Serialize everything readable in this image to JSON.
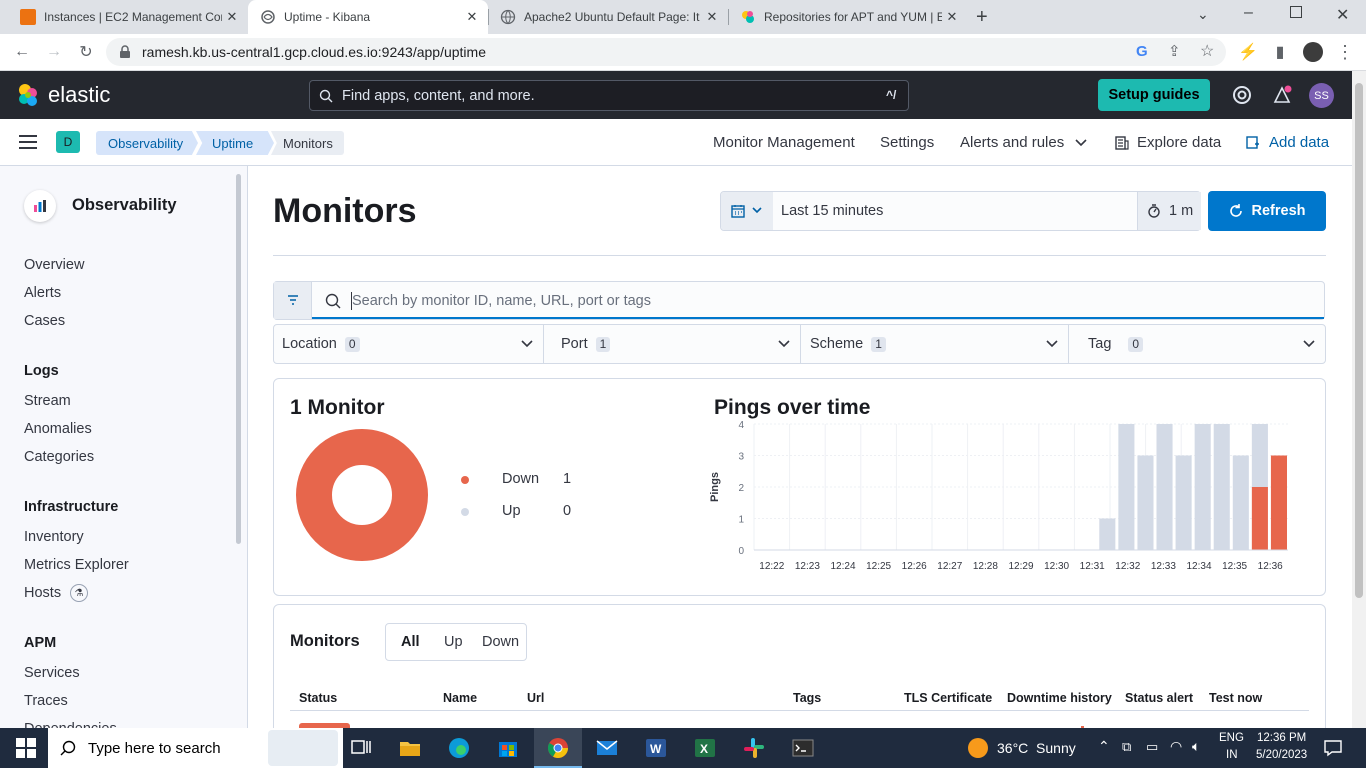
{
  "browser": {
    "tabs": [
      {
        "title": "Instances | EC2 Management Cor",
        "favicon_color": "#ec7211"
      },
      {
        "title": "Uptime - Kibana",
        "favicon_color": "#5f6368"
      },
      {
        "title": "Apache2 Ubuntu Default Page: It",
        "favicon_color": "#5f6368"
      },
      {
        "title": "Repositories for APT and YUM | E",
        "favicon_color": "#00bfb3"
      }
    ],
    "url": "ramesh.kb.us-central1.gcp.cloud.es.io:9243/app/uptime"
  },
  "kibana": {
    "logo_text": "elastic",
    "search_placeholder": "Find apps, content, and more.",
    "search_shortcut": "^/",
    "setup_label": "Setup guides",
    "avatar": "SS",
    "space": "D",
    "breadcrumbs": [
      "Observability",
      "Uptime",
      "Monitors"
    ],
    "nav": {
      "monitor_management": "Monitor Management",
      "settings": "Settings",
      "alerts_rules": "Alerts and rules",
      "explore": "Explore data",
      "add_data": "Add data"
    }
  },
  "sidebar": {
    "title": "Observability",
    "items_top": [
      "Overview",
      "Alerts",
      "Cases"
    ],
    "logs_head": "Logs",
    "logs": [
      "Stream",
      "Anomalies",
      "Categories"
    ],
    "infra_head": "Infrastructure",
    "infra": [
      "Inventory",
      "Metrics Explorer",
      "Hosts"
    ],
    "apm_head": "APM",
    "apm": [
      "Services",
      "Traces",
      "Dependencies"
    ]
  },
  "page": {
    "title": "Monitors",
    "time_range": "Last 15 minutes",
    "refresh_interval": "1 m",
    "refresh_label": "Refresh",
    "search_placeholder": "Search by monitor ID, name, URL, port or tags",
    "filters": [
      {
        "label": "Location",
        "count": "0"
      },
      {
        "label": "Port",
        "count": "1"
      },
      {
        "label": "Scheme",
        "count": "1"
      },
      {
        "label": "Tag",
        "count": "0"
      }
    ],
    "summary_title": "1 Monitor",
    "legend": [
      {
        "label": "Down",
        "value": "1",
        "color": "#e7664c"
      },
      {
        "label": "Up",
        "value": "0",
        "color": "#d3dae6"
      }
    ],
    "monitors_title": "Monitors",
    "status_tabs": [
      "All",
      "Up",
      "Down"
    ],
    "columns": [
      "Status",
      "Name",
      "Url",
      "Tags",
      "TLS Certificate",
      "Downtime history",
      "Status alert",
      "Test now"
    ]
  },
  "chart_data": {
    "type": "bar",
    "title": "Pings over time",
    "ylabel": "Pings",
    "xlabel": "",
    "ylim": [
      0,
      4
    ],
    "yticks": [
      "0",
      "1",
      "2",
      "3",
      "4"
    ],
    "categories": [
      "12:22",
      "12:23",
      "12:24",
      "12:25",
      "12:26",
      "12:27",
      "12:28",
      "12:29",
      "12:30",
      "12:31",
      "12:32",
      "12:33",
      "12:34",
      "12:35",
      "12:36"
    ],
    "series": [
      {
        "name": "Down",
        "color": "#e7664c",
        "values": [
          0,
          0,
          0,
          0,
          0,
          0,
          0,
          0,
          0,
          0,
          0,
          0,
          0,
          0,
          0,
          0,
          0,
          0,
          0,
          0,
          0,
          0,
          0,
          0,
          0,
          0,
          2,
          3
        ]
      },
      {
        "name": "Up",
        "color": "#d3dae6",
        "values": [
          0,
          0,
          0,
          0,
          0,
          0,
          0,
          0,
          0,
          0,
          0,
          0,
          0,
          0,
          0,
          0,
          0,
          0,
          1,
          4,
          3,
          4,
          3,
          4,
          4,
          3,
          2,
          0
        ]
      }
    ]
  },
  "taskbar": {
    "search_placeholder": "Type here to search",
    "weather": "36°C  Sunny",
    "lang1": "ENG",
    "lang2": "IN",
    "time": "12:36 PM",
    "date": "5/20/2023"
  }
}
